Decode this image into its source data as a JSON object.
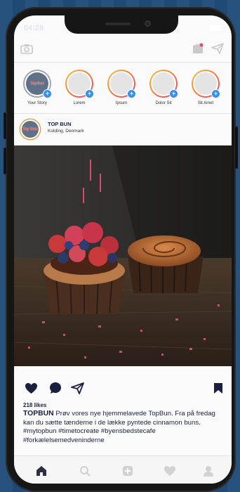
{
  "status_bar": {
    "time": "04:28"
  },
  "topbar": {
    "camera_icon": "camera-icon",
    "igtv_icon": "igtv-icon",
    "direct_icon": "send-icon"
  },
  "stories": [
    {
      "label": "Your Story",
      "own": true,
      "avatar_text": "TopBun"
    },
    {
      "label": "Lorem"
    },
    {
      "label": "Ipsum"
    },
    {
      "label": "Dolor Sit"
    },
    {
      "label": "Sit Amet"
    }
  ],
  "post": {
    "username": "TOP BUN",
    "location": "Kolding, Denmark",
    "avatar_text": "Top Bun",
    "image_description_icon": "cupcakes-photo",
    "likes": "218 likes",
    "caption_user": "TOPBUN",
    "caption_text": " Prøv vores nye hjemmelavede TopBun. Fra på fredag kan du sætte tænderne i de lække pyntede cinnamon buns. #mytopbun #timetocreate #byensbedstecafe #forkælelsemedveninderne"
  },
  "actions": {
    "like_icon": "heart-icon",
    "comment_icon": "comment-icon",
    "share_icon": "send-icon",
    "save_icon": "bookmark-icon"
  },
  "tabbar": {
    "home": "home-icon",
    "search": "search-icon",
    "add": "add-icon",
    "activity": "heart-icon",
    "profile": "profile-icon"
  },
  "colors": {
    "background": "#1f4c79",
    "accent_blue": "#3a8ee6",
    "text": "#1a2140"
  }
}
